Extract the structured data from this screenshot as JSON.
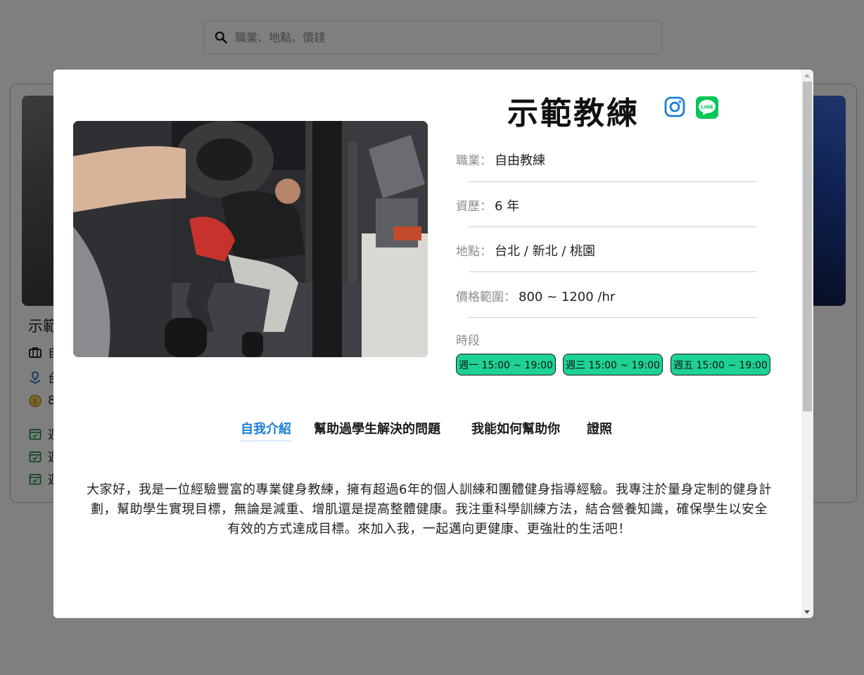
{
  "search": {
    "placeholder": "職業、地點、價錢",
    "icon": "search-icon"
  },
  "background_card": {
    "name": "示範",
    "rows": [
      {
        "icon": "briefcase-icon",
        "text": "自"
      },
      {
        "icon": "location-icon",
        "text": "台"
      },
      {
        "icon": "coin-icon",
        "text": "8"
      },
      {
        "icon": "calendar-icon",
        "text": "週"
      },
      {
        "icon": "calendar-icon",
        "text": "週"
      },
      {
        "icon": "calendar-icon",
        "text": "週"
      }
    ]
  },
  "modal": {
    "name": "示範教練",
    "social": {
      "instagram_icon": "instagram-icon",
      "line_icon": "line-icon",
      "line_text": "LINE"
    },
    "fields": [
      {
        "label": "職業：",
        "value": "自由教練"
      },
      {
        "label": "資歷：",
        "value": "6 年"
      },
      {
        "label": "地點：",
        "value": "台北 / 新北 / 桃園"
      },
      {
        "label": "價格範圍：",
        "value": "800 ~ 1200 /hr"
      }
    ],
    "schedule_label": "時段",
    "slots": [
      "週一 15:00 ~ 19:00",
      "週三 15:00 ~ 19:00",
      "週五 15:00 ~ 19:00"
    ],
    "tabs": [
      "自我介紹",
      "幫助過學生解決的問題",
      "我能如何幫助你",
      "證照"
    ],
    "active_tab": 0,
    "intro": "大家好，我是一位經驗豐富的專業健身教練，擁有超過6年的個人訓練和團體健身指導經驗。我專注於量身定制的健身計劃，幫助學生實現目標，無論是減重、增肌還是提高整體健康。我注重科學訓練方法，結合營養知識，確保學生以安全有效的方式達成目標。來加入我，一起邁向更健康、更強壯的生活吧！"
  },
  "colors": {
    "accent_tab": "#1a7fd4",
    "slot_bg": "#1ed294",
    "instagram": "#1a7fd4",
    "line": "#06c755"
  }
}
